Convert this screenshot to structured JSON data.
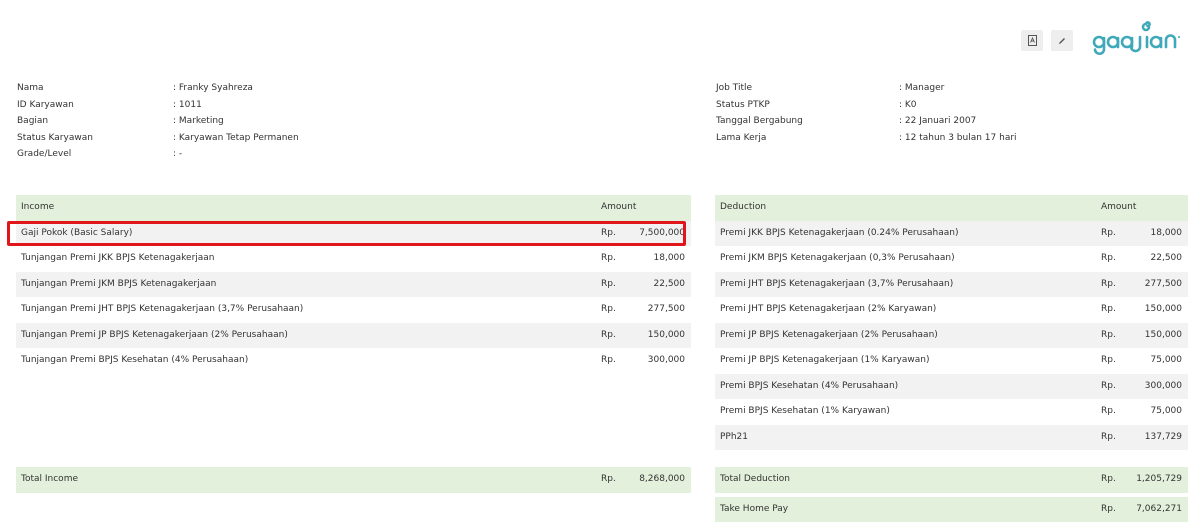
{
  "brand": {
    "name": "gadjian",
    "color": "#3fa9b9"
  },
  "toolbar": {
    "pdf_icon": "pdf-file-icon",
    "edit_icon": "pencil-icon"
  },
  "employee_left": [
    {
      "label": "Nama",
      "value": ": Franky Syahreza"
    },
    {
      "label": "ID Karyawan",
      "value": ": 1011"
    },
    {
      "label": "Bagian",
      "value": ": Marketing"
    },
    {
      "label": "Status Karyawan",
      "value": ": Karyawan Tetap Permanen"
    },
    {
      "label": "Grade/Level",
      "value": ": -"
    }
  ],
  "employee_right": [
    {
      "label": "Job Title",
      "value": ": Manager"
    },
    {
      "label": "Status PTKP",
      "value": ": K0"
    },
    {
      "label": "Tanggal Bergabung",
      "value": ": 22 Januari 2007"
    },
    {
      "label": "Lama Kerja",
      "value": ": 12 tahun 3 bulan 17 hari"
    }
  ],
  "income": {
    "header": "Income",
    "amount_header": "Amount",
    "currency": "Rp.",
    "rows": [
      {
        "name": "Gaji Pokok (Basic Salary)",
        "amount": "7,500,000"
      },
      {
        "name": "Tunjangan Premi JKK BPJS Ketenagakerjaan",
        "amount": "18,000"
      },
      {
        "name": "Tunjangan Premi JKM BPJS Ketenagakerjaan",
        "amount": "22,500"
      },
      {
        "name": "Tunjangan Premi JHT BPJS Ketenagakerjaan (3,7% Perusahaan)",
        "amount": "277,500"
      },
      {
        "name": "Tunjangan Premi JP BPJS Ketenagakerjaan (2% Perusahaan)",
        "amount": "150,000"
      },
      {
        "name": "Tunjangan Premi BPJS Kesehatan (4% Perusahaan)",
        "amount": "300,000"
      }
    ],
    "total_label": "Total Income",
    "total_amount": "8,268,000"
  },
  "deduction": {
    "header": "Deduction",
    "amount_header": "Amount",
    "currency": "Rp.",
    "rows": [
      {
        "name": "Premi JKK BPJS Ketenagakerjaan (0.24% Perusahaan)",
        "amount": "18,000"
      },
      {
        "name": "Premi JKM BPJS Ketenagakerjaan (0,3% Perusahaan)",
        "amount": "22,500"
      },
      {
        "name": "Premi JHT BPJS Ketenagakerjaan (3,7% Perusahaan)",
        "amount": "277,500"
      },
      {
        "name": "Premi JHT BPJS Ketenagakerjaan (2% Karyawan)",
        "amount": "150,000"
      },
      {
        "name": "Premi JP BPJS Ketenagakerjaan (2% Perusahaan)",
        "amount": "150,000"
      },
      {
        "name": "Premi JP BPJS Ketenagakerjaan (1% Karyawan)",
        "amount": "75,000"
      },
      {
        "name": "Premi BPJS Kesehatan (4% Perusahaan)",
        "amount": "300,000"
      },
      {
        "name": "Premi BPJS Kesehatan (1% Karyawan)",
        "amount": "75,000"
      },
      {
        "name": "PPh21",
        "amount": "137,729"
      }
    ],
    "total_label": "Total Deduction",
    "total_amount": "1,205,729",
    "thp_label": "Take Home Pay",
    "thp_amount": "7,062,271"
  },
  "colors": {
    "header_bg": "#e3f0db",
    "row_alt_bg": "#f2f2f2",
    "highlight_border": "#e0161b"
  }
}
